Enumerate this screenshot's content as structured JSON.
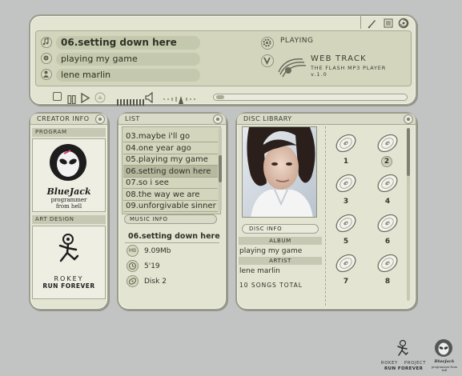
{
  "player": {
    "track_title": "06.setting down here",
    "album": "playing my game",
    "artist": "lene marlin",
    "status": "PLAYING",
    "brand_title": "WEB TRACK",
    "brand_subtitle": "THE FLASH MP3 PLAYER",
    "brand_version": "v.1.0"
  },
  "creator_panel": {
    "title": "CREATOR INFO",
    "program_label": "PROGRAM",
    "program_logo_name": "BlueJack",
    "program_logo_tag1": "programmer",
    "program_logo_tag2": "from hell",
    "design_label": "ART DESIGN",
    "design_name": "ROKEY",
    "design_tag": "RUN FOREVER"
  },
  "list_panel": {
    "title": "LIST",
    "tracks": [
      "03.maybe i'll go",
      "04.one year ago",
      "05.playing my game",
      "06.setting down here",
      "07.so i see",
      "08.the way we are",
      "09.unforgivable sinner"
    ],
    "selected_index": 3,
    "music_info_label": "MUSIC INFO",
    "info_title": "06.setting down here",
    "info_size": "9.09Mb",
    "info_length": "5'19",
    "info_disc": "Disk 2",
    "icon_size": "MB"
  },
  "disc_panel": {
    "title": "DISC LIBRARY",
    "disc_info_label": "DISC INFO",
    "album_label": "ALBUM",
    "album": "playing my game",
    "artist_label": "ARTIST",
    "artist": "lene marlin",
    "total": "10 SONGS TOTAL",
    "discs": [
      "1",
      "2",
      "3",
      "4",
      "5",
      "6",
      "7",
      "8"
    ],
    "selected_disc": "2"
  },
  "footer": {
    "rokey_line1": "ROKEY",
    "rokey_line2": "PROJECT",
    "rokey_line3": "RUN FOREVER",
    "bluejack_line1": "BlueJack",
    "bluejack_line2": "programmer from hell"
  },
  "icons": [
    "music-note-icon",
    "cd-icon",
    "person-icon",
    "gear-icon",
    "v-icon",
    "pen-icon",
    "list-icon",
    "spiral-icon"
  ],
  "colors": {
    "background": "#c2c4c4",
    "panel": "#e4e4d3",
    "screen": "#d3d5bd",
    "highlight": "#c4c8ac"
  }
}
